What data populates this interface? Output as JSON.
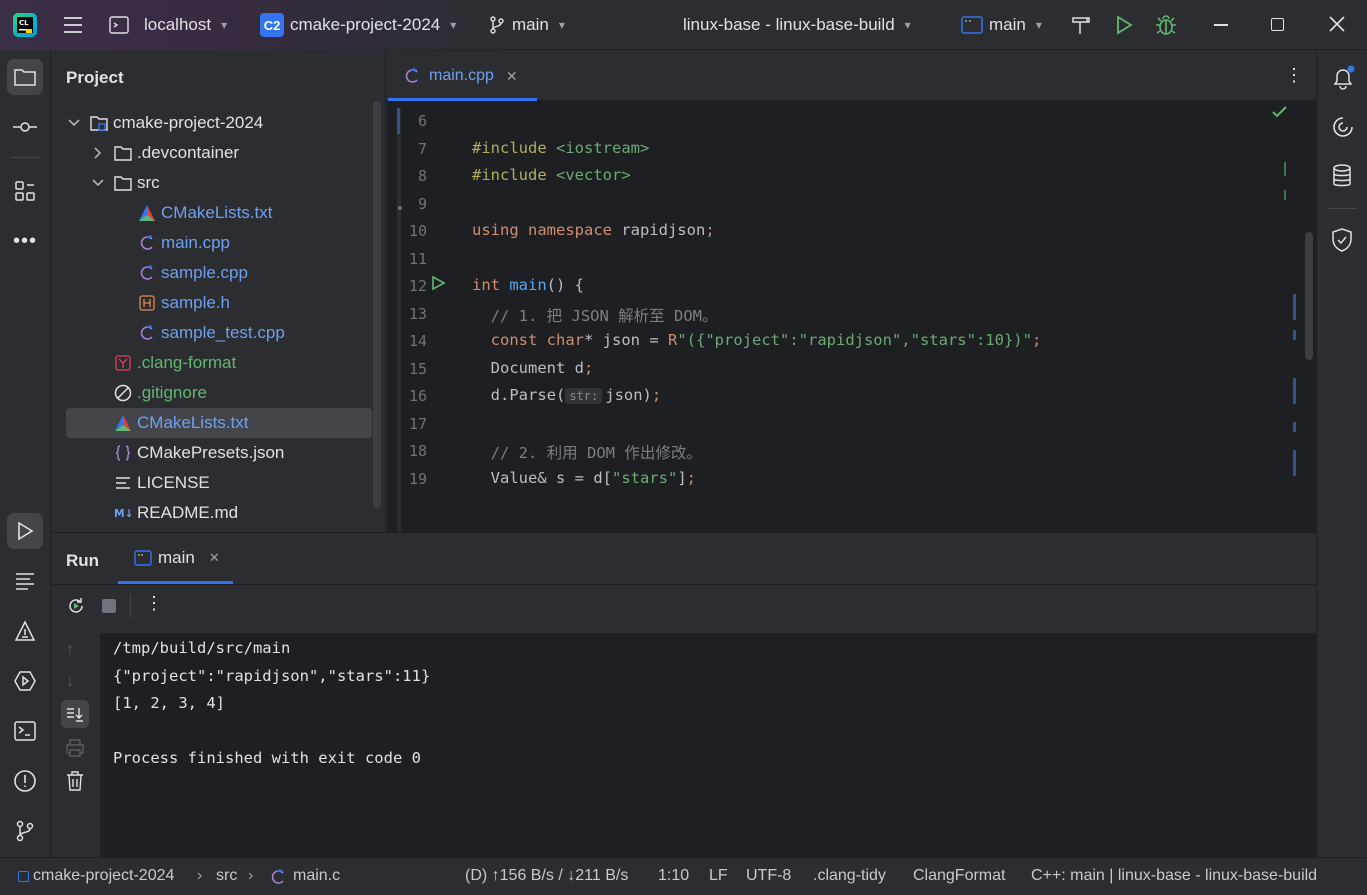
{
  "titlebar": {
    "host": "localhost",
    "project_badge": "C2",
    "project": "cmake-project-2024",
    "branch": "main",
    "build_config": "linux-base - linux-base-build",
    "run_config": "main"
  },
  "project_panel": {
    "title": "Project",
    "items": [
      {
        "label": "cmake-project-2024",
        "type": "module",
        "depth": 0,
        "expanded": true
      },
      {
        "label": ".devcontainer",
        "type": "folder",
        "depth": 1,
        "expanded": false
      },
      {
        "label": "src",
        "type": "folder",
        "depth": 1,
        "expanded": true
      },
      {
        "label": "CMakeLists.txt",
        "type": "cmake",
        "depth": 2,
        "color": "#6ea0f0"
      },
      {
        "label": "main.cpp",
        "type": "cpp",
        "depth": 2,
        "color": "#6ea0f0"
      },
      {
        "label": "sample.cpp",
        "type": "cpp",
        "depth": 2,
        "color": "#6ea0f0"
      },
      {
        "label": "sample.h",
        "type": "header",
        "depth": 2,
        "color": "#6ea0f0"
      },
      {
        "label": "sample_test.cpp",
        "type": "cpp",
        "depth": 2,
        "color": "#6ea0f0"
      },
      {
        "label": ".clang-format",
        "type": "yaml",
        "depth": 1,
        "color": "#5fb870"
      },
      {
        "label": ".gitignore",
        "type": "ignore",
        "depth": 1,
        "color": "#5fb870"
      },
      {
        "label": "CMakeLists.txt",
        "type": "cmake",
        "depth": 1,
        "color": "#6ea0f0",
        "selected": true
      },
      {
        "label": "CMakePresets.json",
        "type": "json",
        "depth": 1,
        "color": "#dfe1e5"
      },
      {
        "label": "LICENSE",
        "type": "text",
        "depth": 1,
        "color": "#dfe1e5"
      },
      {
        "label": "README.md",
        "type": "markdown",
        "depth": 1,
        "color": "#dfe1e5"
      }
    ]
  },
  "editor": {
    "tab": {
      "label": "main.cpp"
    },
    "lines": [
      {
        "n": "6",
        "html": ""
      },
      {
        "n": "7",
        "html": "<span class=\"pp\">#include</span> <span class=\"inc\">&lt;iostream&gt;</span>"
      },
      {
        "n": "8",
        "html": "<span class=\"pp\">#include</span> <span class=\"inc\">&lt;vector&gt;</span>"
      },
      {
        "n": "9",
        "html": ""
      },
      {
        "n": "10",
        "html": "<span class=\"kw\">using namespace</span> rapidjson<span class=\"kw\">;</span>"
      },
      {
        "n": "11",
        "html": ""
      },
      {
        "n": "12",
        "html": "<span class=\"kw\">int</span> <span class=\"fn\">main</span>() {"
      },
      {
        "n": "13",
        "html": "  <span class=\"cmt\">// 1. 把 JSON 解析至 DOM。</span>"
      },
      {
        "n": "14",
        "html": "  <span class=\"kw\">const char</span>* json = <span class=\"kw\">R</span><span class=\"str\">\"({\"project\":\"rapidjson\",\"stars\":10})\"</span><span class=\"kw\">;</span>"
      },
      {
        "n": "15",
        "html": "  Document d<span class=\"kw\">;</span>"
      },
      {
        "n": "16",
        "html": "  d.Parse(<span class=\"hint\">str:</span>json)<span class=\"kw\">;</span>"
      },
      {
        "n": "17",
        "html": ""
      },
      {
        "n": "18",
        "html": "  <span class=\"cmt\">// 2. 利用 DOM 作出修改。</span>"
      },
      {
        "n": "19",
        "html": "  Value&amp; s = d[<span class=\"str\">\"stars\"</span>]<span class=\"kw\">;</span>"
      }
    ]
  },
  "run_panel": {
    "title": "Run",
    "tab": "main",
    "output": [
      "/tmp/build/src/main",
      "{\"project\":\"rapidjson\",\"stars\":11}",
      "[1, 2, 3, 4]",
      "",
      "Process finished with exit code 0"
    ]
  },
  "statusbar": {
    "breadcrumb": [
      "cmake-project-2024",
      "src",
      "main.c"
    ],
    "network": "(D) ↑156 B/s / ↓211 B/s",
    "position": "1:10",
    "line_ending": "LF",
    "encoding": "UTF-8",
    "linter": ".clang-tidy",
    "formatter": "ClangFormat",
    "context": "C++: main | linux-base - linux-base-build"
  },
  "colors": {
    "accent": "#3574f0",
    "run_green": "#5fb870",
    "bg_dark": "#1e1f22",
    "panel": "#2b2d30"
  }
}
